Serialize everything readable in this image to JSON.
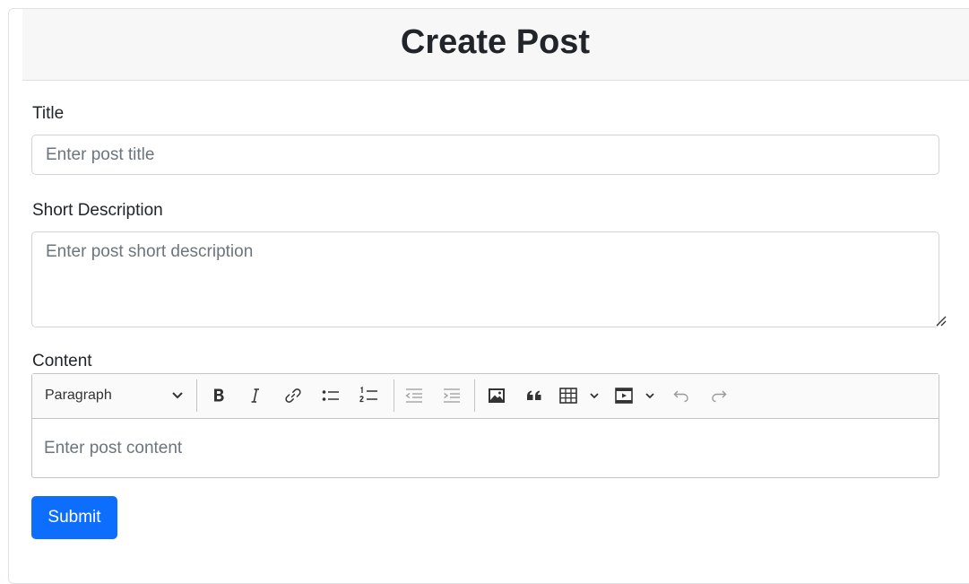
{
  "card": {
    "title": "Create Post"
  },
  "form": {
    "title_label": "Title",
    "title_placeholder": "Enter post title",
    "description_label": "Short Description",
    "description_placeholder": "Enter post short description",
    "content_label": "Content",
    "content_placeholder": "Enter post content",
    "submit_label": "Submit"
  },
  "editor": {
    "heading_value": "Paragraph",
    "toolbar_icons": [
      "bold-icon",
      "italic-icon",
      "link-icon",
      "bulleted-list-icon",
      "numbered-list-icon",
      "outdent-icon",
      "indent-icon",
      "insert-image-icon",
      "block-quote-icon",
      "insert-table-icon",
      "insert-media-icon",
      "undo-icon",
      "redo-icon"
    ]
  },
  "colors": {
    "primary": "#0d6efd",
    "header_bg": "#f7f7f7",
    "placeholder": "#6c757d"
  }
}
